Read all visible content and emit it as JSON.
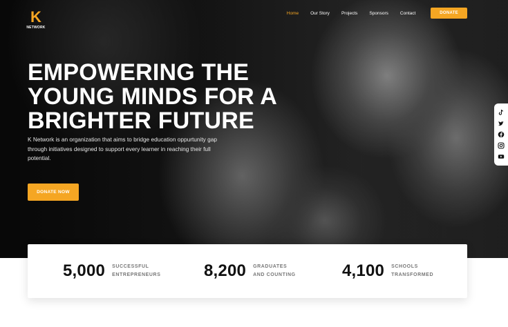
{
  "brand": {
    "letter": "K",
    "word": "NETWORK"
  },
  "nav": {
    "items": [
      "Home",
      "Our Story",
      "Projects",
      "Sponsors",
      "Contact"
    ],
    "active_index": 0,
    "donate_label": "DONATE"
  },
  "hero": {
    "headline": "EMPOWERING THE YOUNG MINDS FOR A BRIGHTER FUTURE",
    "intro": "K Network is an organization that aims to bridge education oppurtunity gap through initiatives designed to support every learner in reaching their full potential.",
    "cta_label": "DONATE NOW"
  },
  "social": [
    "tiktok-icon",
    "twitter-icon",
    "facebook-icon",
    "instagram-icon",
    "youtube-icon"
  ],
  "stats": [
    {
      "number": "5,000",
      "label_line1": "SUCCESSFUL",
      "label_line2": "ENTREPRENEURS"
    },
    {
      "number": "8,200",
      "label_line1": "GRADUATES",
      "label_line2": "AND COUNTING"
    },
    {
      "number": "4,100",
      "label_line1": "SCHOOLS",
      "label_line2": "TRANSFORMED"
    }
  ],
  "colors": {
    "accent": "#f5a623",
    "text_dark": "#111111",
    "label_gray": "#777777"
  }
}
